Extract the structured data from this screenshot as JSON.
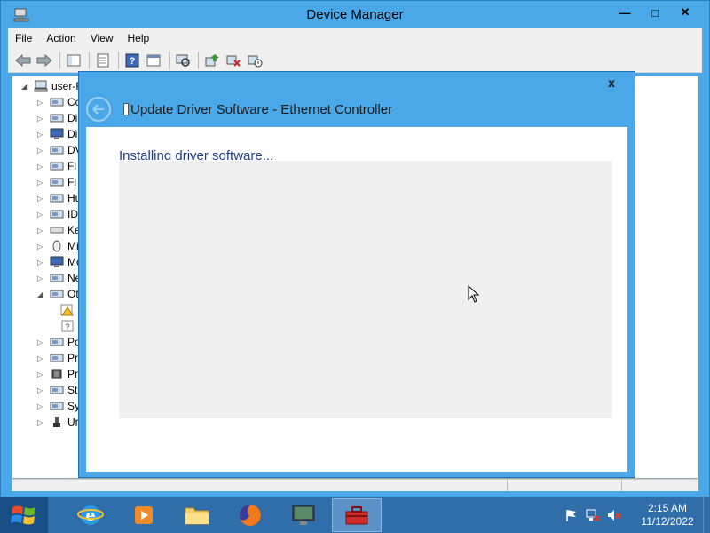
{
  "device_manager": {
    "title": "Device Manager",
    "menu": [
      "File",
      "Action",
      "View",
      "Help"
    ],
    "toolbar_icons": [
      "back-arrow-icon",
      "forward-arrow-icon",
      "show-hide-tree-icon",
      "properties-icon",
      "help-icon",
      "console-icon",
      "scan-hardware-icon",
      "update-driver-icon",
      "uninstall-icon",
      "disable-icon"
    ],
    "tree": {
      "root": "user-F",
      "items": [
        {
          "label": "Co",
          "icon": "computer-icon",
          "expanded": false
        },
        {
          "label": "Di",
          "icon": "disk-drive-icon",
          "expanded": false
        },
        {
          "label": "Di",
          "icon": "display-adapter-icon",
          "expanded": false
        },
        {
          "label": "DV",
          "icon": "dvd-drive-icon",
          "expanded": false
        },
        {
          "label": "Fl",
          "icon": "floppy-controller-icon",
          "expanded": false
        },
        {
          "label": "Fl",
          "icon": "floppy-drive-icon",
          "expanded": false
        },
        {
          "label": "Hu",
          "icon": "hid-icon",
          "expanded": false
        },
        {
          "label": "ID",
          "icon": "ide-controller-icon",
          "expanded": false
        },
        {
          "label": "Ke",
          "icon": "keyboard-icon",
          "expanded": false
        },
        {
          "label": "Mi",
          "icon": "mouse-icon",
          "expanded": false
        },
        {
          "label": "Mo",
          "icon": "monitor-icon",
          "expanded": false
        },
        {
          "label": "Ne",
          "icon": "network-adapter-icon",
          "expanded": false
        },
        {
          "label": "Ot",
          "icon": "other-devices-icon",
          "expanded": true
        },
        {
          "label": "",
          "icon": "unknown-device-warning-icon",
          "child": true
        },
        {
          "label": "",
          "icon": "unknown-device-icon",
          "child": true
        },
        {
          "label": "Po",
          "icon": "ports-icon",
          "expanded": false
        },
        {
          "label": "Pr",
          "icon": "print-queue-icon",
          "expanded": false
        },
        {
          "label": "Pr",
          "icon": "processor-icon",
          "expanded": false
        },
        {
          "label": "St",
          "icon": "storage-controller-icon",
          "expanded": false
        },
        {
          "label": "Sy",
          "icon": "system-devices-icon",
          "expanded": false
        },
        {
          "label": "Ur",
          "icon": "usb-controller-icon",
          "expanded": false
        }
      ]
    }
  },
  "dialog": {
    "title": "Update Driver Software - Ethernet Controller",
    "heading": "Installing driver software...",
    "close_label": "x"
  },
  "taskbar": {
    "apps": [
      "internet-explorer-icon",
      "media-player-icon",
      "file-explorer-icon",
      "firefox-icon",
      "server-manager-icon",
      "toolbox-icon"
    ],
    "active_app": "toolbox-icon",
    "tray_icons": [
      "action-center-flag-icon",
      "network-icon",
      "volume-muted-icon"
    ],
    "time": "2:15 AM",
    "date": "11/12/2022"
  }
}
